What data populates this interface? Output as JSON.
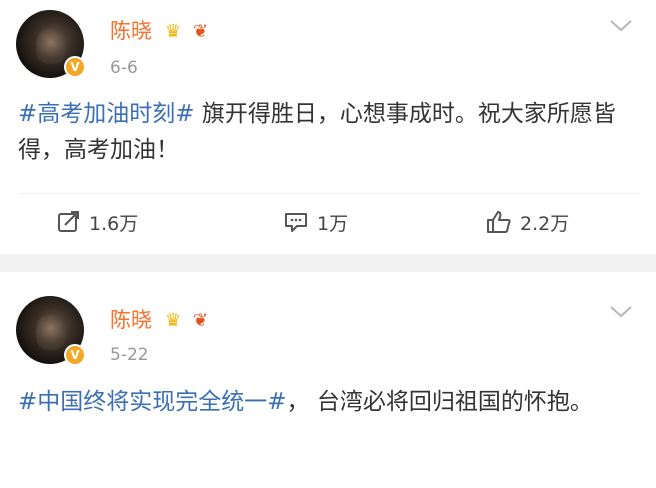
{
  "posts": [
    {
      "author": "陈晓",
      "date": "6-6",
      "verified_badge": "V",
      "tag": "#高考加油时刻#",
      "text": " 旗开得胜日，心想事成时。祝大家所愿皆得，高考加油！",
      "actions": {
        "repost": "1.6万",
        "comment": "1万",
        "like": "2.2万"
      },
      "icons": [
        "crown-icon",
        "worm-icon",
        "chevron-down-icon",
        "repost-icon",
        "comment-icon",
        "like-icon"
      ]
    },
    {
      "author": "陈晓",
      "date": "5-22",
      "verified_badge": "V",
      "tag": "#中国终将实现完全统一#",
      "text": "， 台湾必将回归祖国的怀抱。",
      "icons": [
        "crown-icon",
        "worm-icon",
        "chevron-down-icon"
      ]
    }
  ],
  "colors": {
    "name": "#f7702c",
    "tag": "#3a6fb6",
    "divider_band": "#f2f2f2",
    "badge": "#f5a623"
  }
}
